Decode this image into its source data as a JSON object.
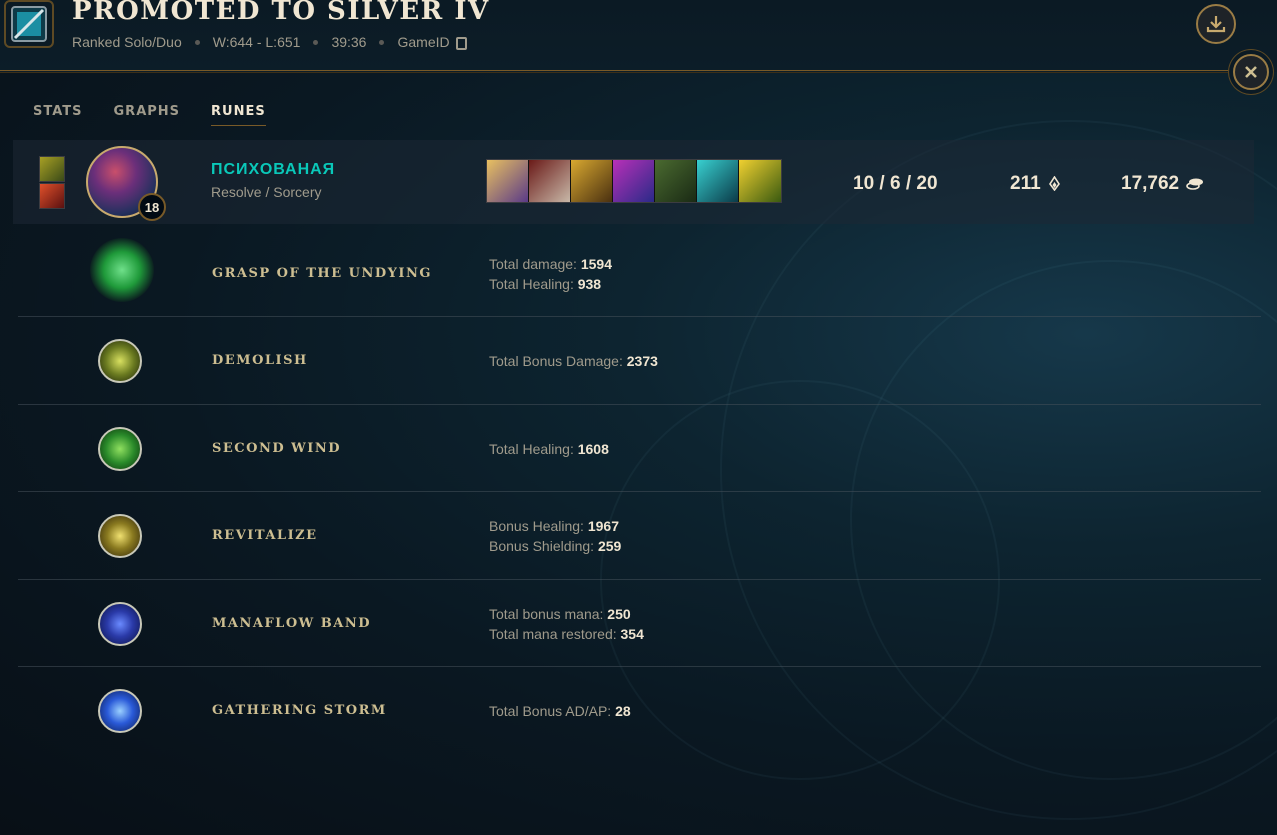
{
  "header": {
    "title": "PROMOTED TO SILVER IV",
    "queue": "Ranked Solo/Duo",
    "record": "W:644 - L:651",
    "duration": "39:36",
    "game_id_label": "GameID"
  },
  "tabs": [
    {
      "label": "STATS"
    },
    {
      "label": "GRAPHS"
    },
    {
      "label": "RUNES",
      "active": true
    }
  ],
  "player": {
    "name": "ПСИХОВАНАЯ",
    "rune_paths": "Resolve / Sorcery",
    "level": "18",
    "kda": "10 / 6 / 20",
    "cs": "211",
    "gold": "17,762"
  },
  "runes": [
    {
      "name": "GRASP OF THE UNDYING",
      "stats": [
        {
          "label": "Total damage:",
          "value": "1594"
        },
        {
          "label": "Total Healing:",
          "value": "938"
        }
      ]
    },
    {
      "name": "DEMOLISH",
      "stats": [
        {
          "label": "Total Bonus Damage:",
          "value": "2373"
        }
      ]
    },
    {
      "name": "SECOND WIND",
      "stats": [
        {
          "label": "Total Healing:",
          "value": "1608"
        }
      ]
    },
    {
      "name": "REVITALIZE",
      "stats": [
        {
          "label": "Bonus Healing:",
          "value": "1967"
        },
        {
          "label": "Bonus Shielding:",
          "value": "259"
        }
      ]
    },
    {
      "name": "MANAFLOW BAND",
      "stats": [
        {
          "label": "Total bonus mana:",
          "value": "250"
        },
        {
          "label": "Total mana restored:",
          "value": "354"
        }
      ]
    },
    {
      "name": "GATHERING STORM",
      "stats": [
        {
          "label": "Total Bonus AD/AP:",
          "value": "28"
        }
      ]
    }
  ],
  "colors": {
    "gold_accent": "#c8aa6e",
    "player_name": "#0ac8b9",
    "text_light": "#f0e6d2",
    "text_muted": "#a09b8c"
  }
}
